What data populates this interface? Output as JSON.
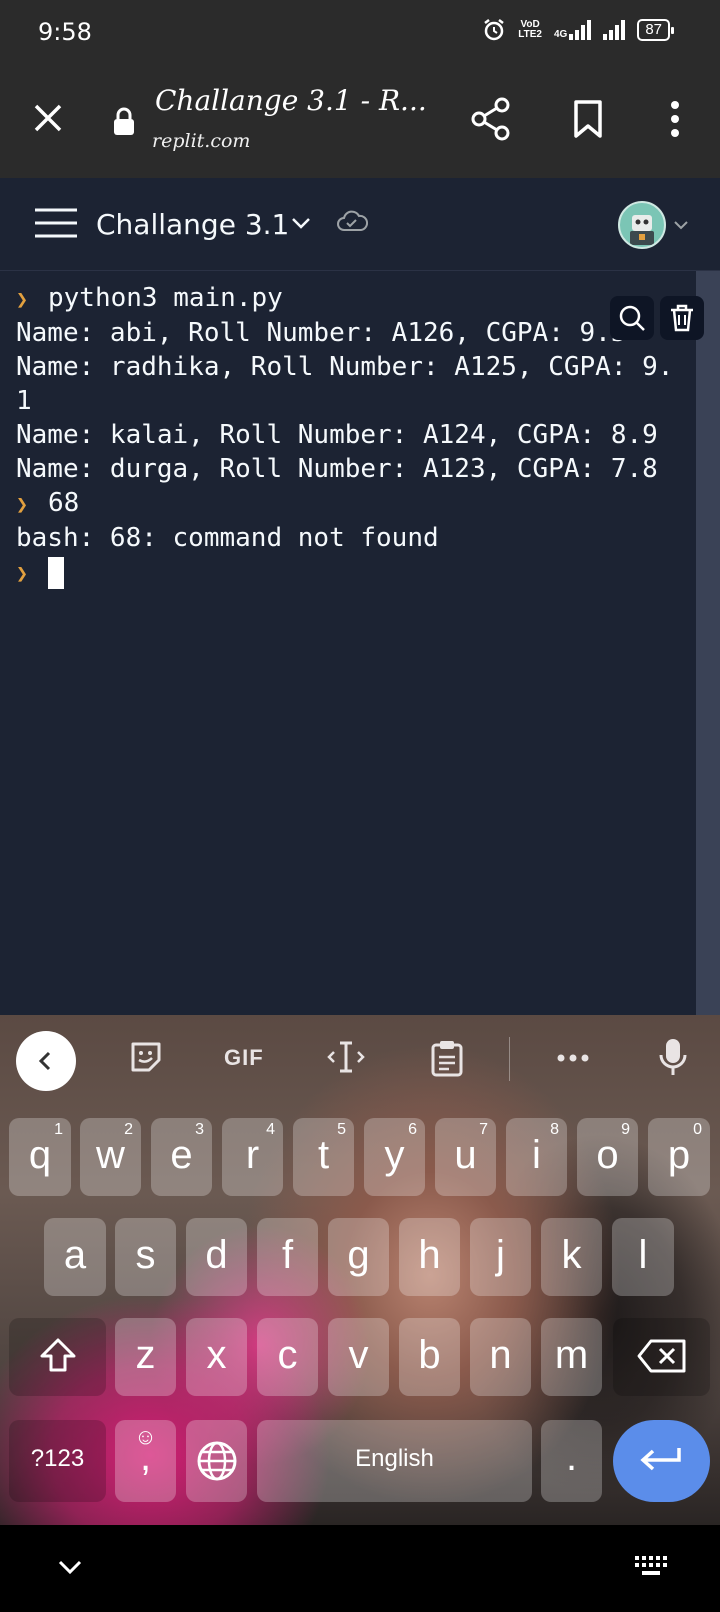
{
  "status_bar": {
    "time": "9:58",
    "network_label_top": "VoD",
    "network_label_bottom": "LTE2",
    "data_type": "4G",
    "battery": "87"
  },
  "browser": {
    "page_title": "Challange 3.1 - R...",
    "url": "replit.com"
  },
  "repl_header": {
    "title": "Challange 3.1"
  },
  "console": {
    "lines": [
      {
        "prompt": true,
        "text": "python3 main.py"
      },
      {
        "prompt": false,
        "text": "Name: abi, Roll Number: A126, CGPA: 9.5"
      },
      {
        "prompt": false,
        "text": "Name: radhika, Roll Number: A125, CGPA: 9."
      },
      {
        "prompt": false,
        "text": "1"
      },
      {
        "prompt": false,
        "text": "Name: kalai, Roll Number: A124, CGPA: 8.9"
      },
      {
        "prompt": false,
        "text": "Name: durga, Roll Number: A123, CGPA: 7.8"
      },
      {
        "prompt": true,
        "text": "68"
      },
      {
        "prompt": false,
        "text": "bash: 68: command not found"
      }
    ]
  },
  "keyboard": {
    "toolbar": {
      "gif": "GIF"
    },
    "row1": [
      {
        "k": "q",
        "n": "1"
      },
      {
        "k": "w",
        "n": "2"
      },
      {
        "k": "e",
        "n": "3"
      },
      {
        "k": "r",
        "n": "4"
      },
      {
        "k": "t",
        "n": "5"
      },
      {
        "k": "y",
        "n": "6"
      },
      {
        "k": "u",
        "n": "7"
      },
      {
        "k": "i",
        "n": "8"
      },
      {
        "k": "o",
        "n": "9"
      },
      {
        "k": "p",
        "n": "0"
      }
    ],
    "row2": [
      "a",
      "s",
      "d",
      "f",
      "g",
      "h",
      "j",
      "k",
      "l"
    ],
    "row3": [
      "z",
      "x",
      "c",
      "v",
      "b",
      "n",
      "m"
    ],
    "symbols_label": "?123",
    "comma": ",",
    "emoji_hint": "☺",
    "space_label": "English",
    "period": "."
  },
  "colors": {
    "console_bg": "#1c2333",
    "prompt": "#e2a03f",
    "enter_key": "#5b8dea"
  }
}
